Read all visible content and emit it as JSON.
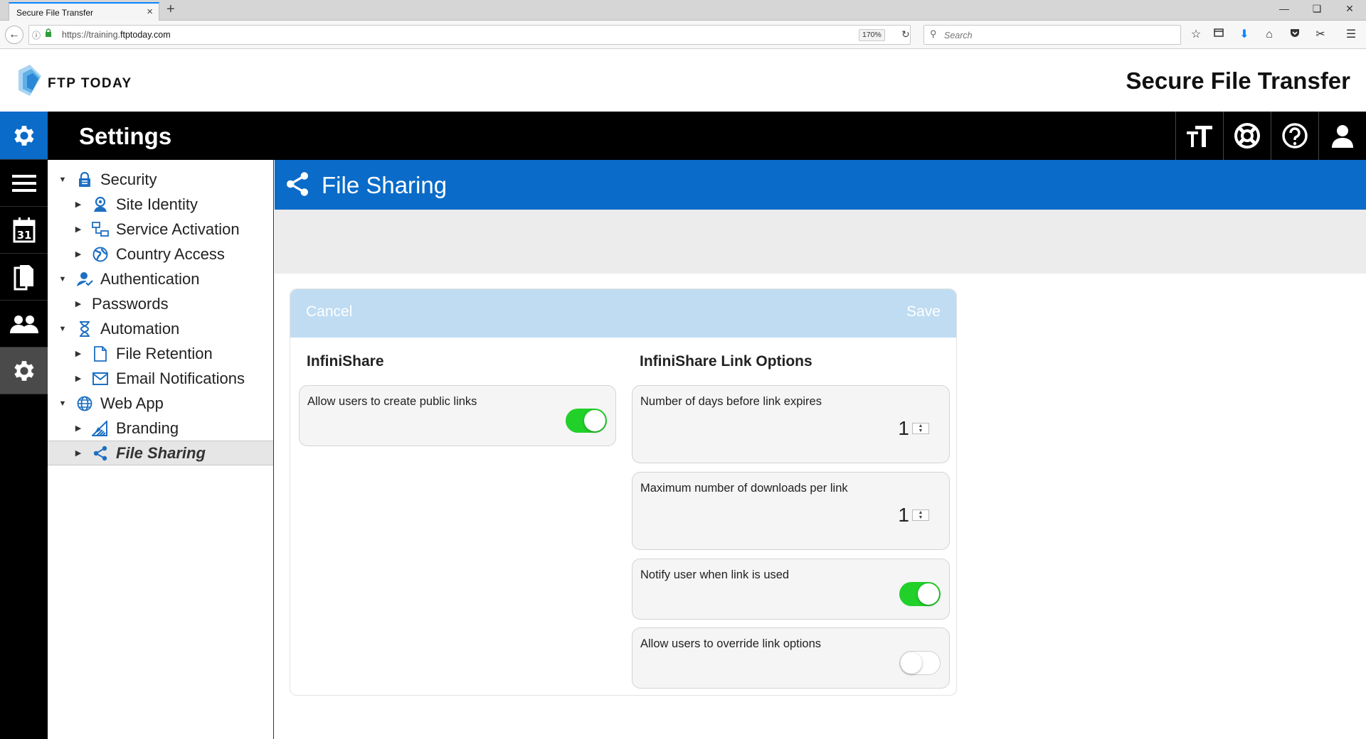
{
  "browser": {
    "tab_title": "Secure File Transfer",
    "tab_close": "×",
    "new_tab": "+",
    "url_prefix": "https://training.",
    "url_domain": "ftptoday.com",
    "zoom": "170%",
    "search_placeholder": "Search"
  },
  "header": {
    "logo_text": "FTP TODAY",
    "app_title": "Secure File Transfer"
  },
  "topbar": {
    "title": "Settings"
  },
  "tree": {
    "items": [
      {
        "label": "Security"
      },
      {
        "label": "Site Identity"
      },
      {
        "label": "Service Activation"
      },
      {
        "label": "Country Access"
      },
      {
        "label": "Authentication"
      },
      {
        "label": "Passwords"
      },
      {
        "label": "Automation"
      },
      {
        "label": "File Retention"
      },
      {
        "label": "Email Notifications"
      },
      {
        "label": "Web App"
      },
      {
        "label": "Branding"
      },
      {
        "label": "File Sharing"
      }
    ]
  },
  "page": {
    "title": "File Sharing",
    "cancel_label": "Cancel",
    "save_label": "Save",
    "left_section_title": "InfiniShare",
    "right_section_title": "InfiniShare Link Options",
    "options": {
      "allow_public_links": {
        "label": "Allow users to create public links",
        "enabled": true
      },
      "days_before_expire": {
        "label": "Number of days before link expires",
        "value": "1"
      },
      "max_downloads": {
        "label": "Maximum number of downloads per link",
        "value": "1"
      },
      "notify_user": {
        "label": "Notify user when link is used",
        "enabled": true
      },
      "allow_override": {
        "label": "Allow users to override link options",
        "enabled": false
      }
    }
  },
  "colors": {
    "brand_blue": "#0a6bc8",
    "panel_header": "#bfdcf2",
    "toggle_on": "#22d02a",
    "tree_icon": "#1d6fc2"
  }
}
